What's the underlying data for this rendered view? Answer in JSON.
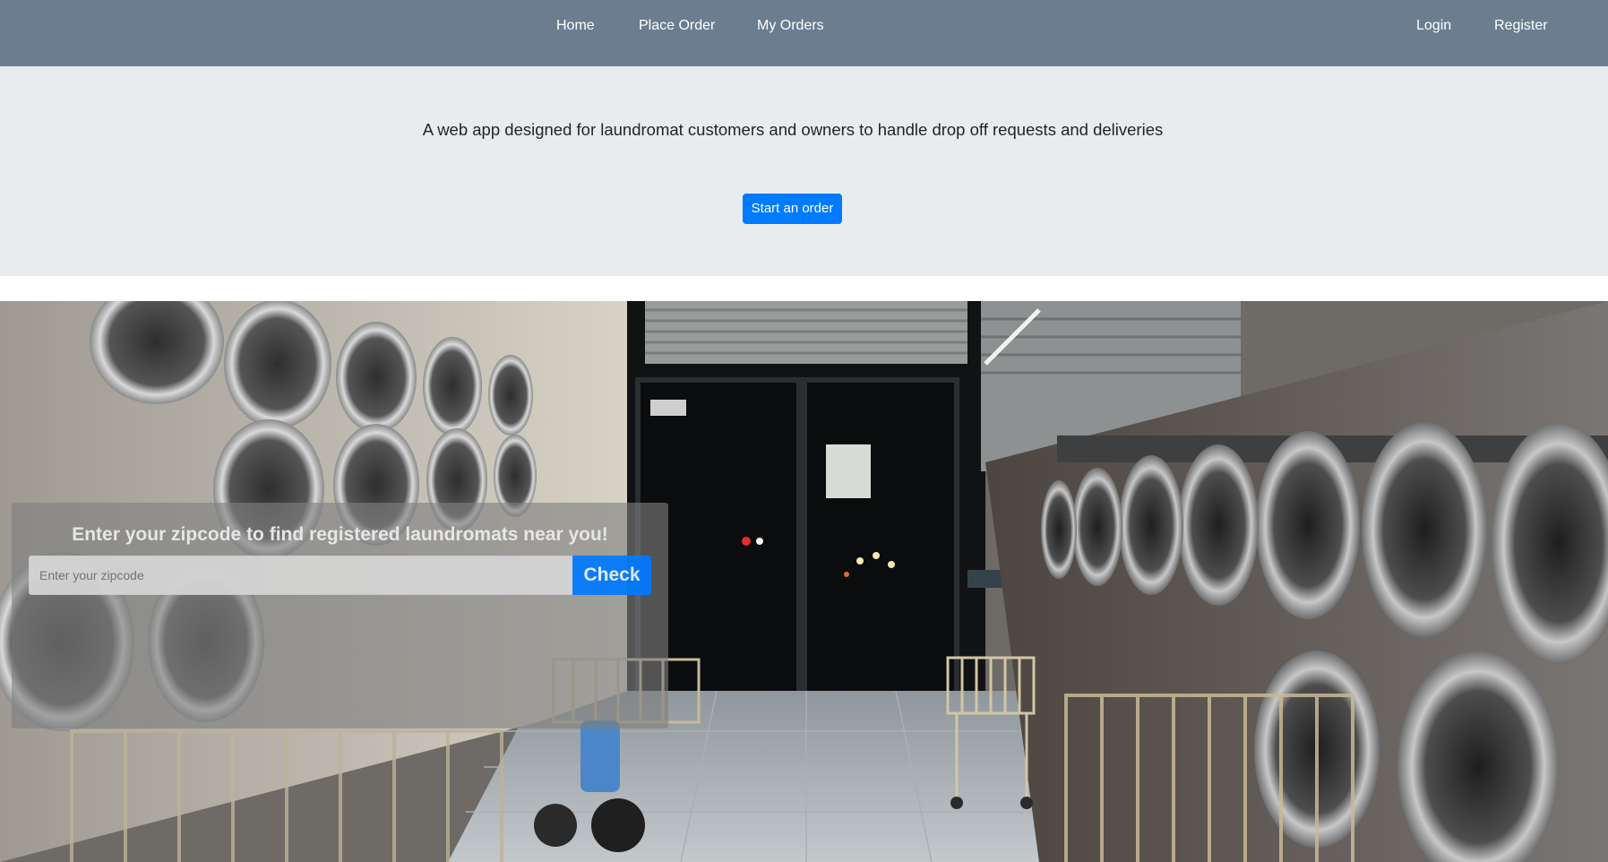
{
  "nav": {
    "home": "Home",
    "place_order": "Place Order",
    "my_orders": "My Orders",
    "login": "Login",
    "register": "Register"
  },
  "jumbotron": {
    "tagline": "A web app designed for laundromat customers and owners to handle drop off requests and deliveries",
    "start_button": "Start an order"
  },
  "hero": {
    "image": "laundromat-photo",
    "zip_heading": "Enter your zipcode to find registered laundromats near you!",
    "zip_placeholder": "Enter your zipcode",
    "zip_value": "",
    "check_button": "Check"
  },
  "colors": {
    "navbar": "#6c7d8f",
    "jumbotron": "#e9ecef",
    "primary": "#007bff"
  }
}
